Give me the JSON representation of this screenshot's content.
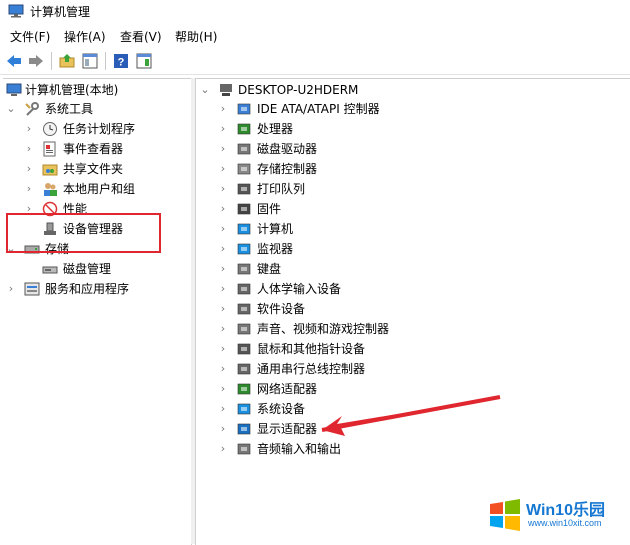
{
  "window": {
    "title": "计算机管理"
  },
  "menu": [
    "文件(F)",
    "操作(A)",
    "查看(V)",
    "帮助(H)"
  ],
  "left_tree": {
    "root": "计算机管理(本地)",
    "system_tools": "系统工具",
    "system_children": [
      "任务计划程序",
      "事件查看器",
      "共享文件夹",
      "本地用户和组",
      "性能",
      "设备管理器"
    ],
    "storage": "存储",
    "storage_children": [
      "磁盘管理"
    ],
    "services": "服务和应用程序"
  },
  "right_tree": {
    "root": "DESKTOP-U2HDERM",
    "items": [
      "IDE ATA/ATAPI 控制器",
      "处理器",
      "磁盘驱动器",
      "存储控制器",
      "打印队列",
      "固件",
      "计算机",
      "监视器",
      "键盘",
      "人体学输入设备",
      "软件设备",
      "声音、视频和游戏控制器",
      "鼠标和其他指针设备",
      "通用串行总线控制器",
      "网络适配器",
      "系统设备",
      "显示适配器",
      "音频输入和输出"
    ]
  },
  "watermark": {
    "brand": "Win10乐园",
    "url": "www.win10xit.com"
  },
  "colors": {
    "annotation_red": "#e0262e",
    "brand_blue": "#1677d2"
  }
}
